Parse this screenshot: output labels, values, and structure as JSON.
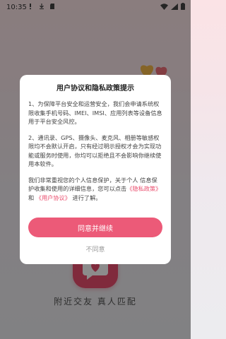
{
  "status_bar": {
    "time": "10:35"
  },
  "background": {
    "slogan": "附近交友 真人匹配"
  },
  "dialog": {
    "title": "用户协议和隐私政策提示",
    "para1": "1、为保障平台安全和运营安全，我们会申请系统权限收集手机号码、IMEI、IMSI、应用列表等设备信息用于平台安全风控。",
    "para2": "2、通讯录、GPS、摄像头、麦克风、相册等敏感权限均不会默认开启，只有经过明示授权才会为实现功能或服务时使用，你均可以拒绝且不会影响你继续使用本软件。",
    "para3_part1": "我们非常重视您的个人信息保护，关于个人 信息保护收集和使用的详细信息，您可以点击",
    "privacy_link": "《隐私政策》",
    "and_text": " 和 ",
    "agreement_link": "《用户协议》",
    "para3_end": " 进行了解。",
    "agree_label": "同意并继续",
    "disagree_label": "不同意"
  },
  "colors": {
    "accent": "#ec5a78",
    "brand": "#ea4d6d"
  }
}
